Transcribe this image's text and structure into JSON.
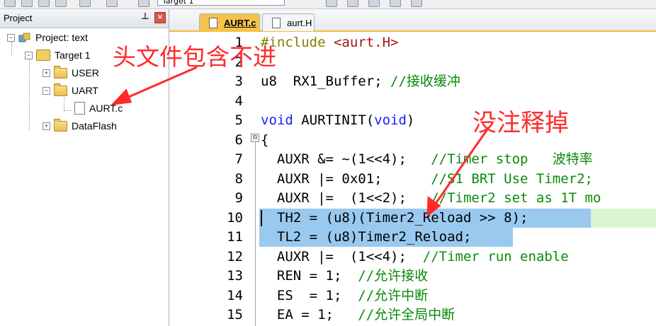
{
  "toolbar": {
    "target_combo": "Target 1",
    "icons": [
      "translate-icon",
      "build-icon",
      "rebuild-icon",
      "batch-build-icon",
      "stop-build-icon",
      "download-icon",
      "options-icon",
      "manage-icon"
    ]
  },
  "project_panel": {
    "title": "Project",
    "pin_icon": "pin-icon",
    "close_icon": "close-icon",
    "tree": {
      "project": "Project: text",
      "target": "Target 1",
      "groups": [
        {
          "label": "USER",
          "expanded": false
        },
        {
          "label": "UART",
          "expanded": true,
          "files": [
            "AURT.c"
          ]
        },
        {
          "label": "DataFlash",
          "expanded": false
        }
      ]
    }
  },
  "editor": {
    "tabs": [
      {
        "label": "AURT.c",
        "active": true
      },
      {
        "label": "aurt.H",
        "active": false
      }
    ],
    "lines": [
      {
        "n": "1"
      },
      {
        "n": "2"
      },
      {
        "n": "3"
      },
      {
        "n": "4"
      },
      {
        "n": "5"
      },
      {
        "n": "6"
      },
      {
        "n": "7"
      },
      {
        "n": "8"
      },
      {
        "n": "9"
      },
      {
        "n": "10"
      },
      {
        "n": "11"
      },
      {
        "n": "12"
      },
      {
        "n": "13"
      },
      {
        "n": "14"
      },
      {
        "n": "15"
      }
    ],
    "code": {
      "l1_pp": "#include",
      "l1_str": " <aurt.H>",
      "l3_type": "u8",
      "l3_rest": "  RX1_Buffer; ",
      "l3_cm": "//接收缓冲",
      "l5_kw1": "void",
      "l5_mid": " AURTINIT(",
      "l5_kw2": "void",
      "l5_end": ")",
      "l6": "{",
      "l7": "  AUXR &= ~(1<<4);   ",
      "l7_cm": "//Timer stop   波特率",
      "l8": "  AUXR |= 0x01;      ",
      "l8_cm": "//S1 BRT Use Timer2;",
      "l9": "  AUXR |=  (1<<2);   ",
      "l9_cm": "//Timer2 set as 1T mo",
      "l10": "  TH2 = (u8)(Timer2_Reload >> 8);",
      "l11": "  TL2 = (u8)Timer2_Reload;",
      "l12": "  AUXR |=  (1<<4);  ",
      "l12_cm": "//Timer run enable",
      "l13": "  REN = 1;  ",
      "l13_cm": "//允许接收",
      "l14": "  ES  = 1;  ",
      "l14_cm": "//允许中断",
      "l15": "  EA = 1;   ",
      "l15_cm": "//允许全局中断"
    },
    "fold_marker": "⊟"
  },
  "annotations": {
    "header_note": "头文件包含不进",
    "comment_note": "没注释掉"
  },
  "colors": {
    "annotation": "#ff2b2b",
    "selection": "#99c9ef",
    "current_line": "#d9f5d0",
    "active_tab": "#f5c34a",
    "keyword": "#1b1bff",
    "comment": "#0a8a0a"
  }
}
